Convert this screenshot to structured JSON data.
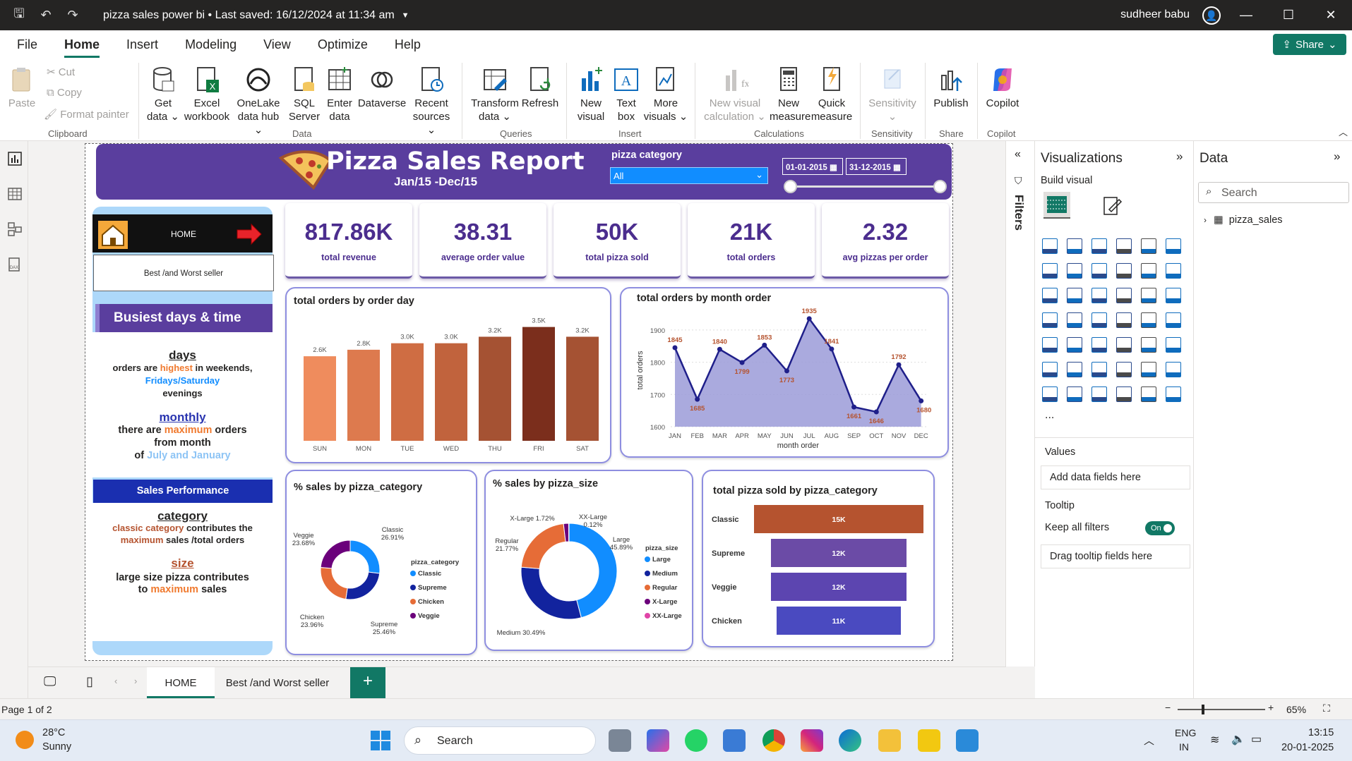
{
  "titlebar": {
    "doc_title": "pizza sales power bi • Last saved: 16/12/2024 at 11:34 am",
    "user": "sudheer babu"
  },
  "menu": {
    "items": [
      "File",
      "Home",
      "Insert",
      "Modeling",
      "View",
      "Optimize",
      "Help"
    ],
    "active": "Home",
    "share": "Share"
  },
  "ribbon": {
    "clipboard": {
      "paste": "Paste",
      "cut": "Cut",
      "copy": "Copy",
      "format_painter": "Format painter",
      "group": "Clipboard"
    },
    "data": {
      "get_data": "Get data",
      "excel": "Excel workbook",
      "onelake": "OneLake data hub",
      "sql": "SQL Server",
      "enter": "Enter data",
      "dataverse": "Dataverse",
      "recent": "Recent sources",
      "group": "Data"
    },
    "queries": {
      "transform": "Transform data",
      "refresh": "Refresh",
      "group": "Queries"
    },
    "insert": {
      "new_visual": "New visual",
      "text_box": "Text box",
      "more_visuals": "More visuals",
      "group": "Insert"
    },
    "calculations": {
      "new_visual_calc": "New visual calculation",
      "new_measure": "New measure",
      "quick_measure": "Quick measure",
      "group": "Calculations"
    },
    "sensitivity": {
      "label": "Sensitivity",
      "group": "Sensitivity"
    },
    "share": {
      "publish": "Publish",
      "group": "Share"
    },
    "copilot": {
      "label": "Copilot",
      "group": "Copilot"
    }
  },
  "report": {
    "title": "Pizza Sales Report",
    "subtitle": "Jan/15 -Dec/15",
    "slicer_label": "pizza category",
    "slicer_value": "All",
    "date_from": "01-01-2015",
    "date_to": "31-12-2015",
    "nav_home": "HOME",
    "nav_best": "Best /and Worst seller",
    "busiest_header": "Busiest days & time",
    "days_head": "days",
    "days_t1": "orders are ",
    "days_t2": "highest",
    "days_t3": " in weekends,",
    "days_t4": "Fridays/Saturday",
    "days_t5": "evenings",
    "monthly_head": "monthly",
    "m_t1": "there are ",
    "m_t2": "maximum",
    "m_t3": " orders",
    "m_t4": "from month",
    "m_t5": "of ",
    "m_t6": "July and  January",
    "perf_header": "Sales Performance",
    "cat_head": "category",
    "c_t1": "classic category",
    "c_t2": " contributes the",
    "c_t3": "maximum",
    "c_t4": " sales /total orders",
    "size_head": "size",
    "s_t1": "large size pizza contributes",
    "s_t2": "to ",
    "s_t3": "maximum",
    "s_t4": " sales"
  },
  "kpis": [
    {
      "value": "817.86K",
      "label": "total revenue"
    },
    {
      "value": "38.31",
      "label": "average order value"
    },
    {
      "value": "50K",
      "label": "total pizza sold"
    },
    {
      "value": "21K",
      "label": "total orders"
    },
    {
      "value": "2.32",
      "label": "avg pizzas per order"
    }
  ],
  "chart_data": [
    {
      "type": "bar",
      "title": "total orders by order day",
      "categories": [
        "SUN",
        "MON",
        "TUE",
        "WED",
        "THU",
        "FRI",
        "SAT"
      ],
      "values": [
        2.6,
        2.8,
        3.0,
        3.0,
        3.2,
        3.5,
        3.2
      ],
      "labels": [
        "2.6K",
        "2.8K",
        "3.0K",
        "3.0K",
        "3.2K",
        "3.5K",
        "3.2K"
      ],
      "colors": [
        "#ef8c5d",
        "#dd7a4e",
        "#cf6d43",
        "#c1633d",
        "#a55233",
        "#7b2e1c",
        "#a55233"
      ]
    },
    {
      "type": "area",
      "title": "total orders by month order",
      "xlabel": "month order",
      "ylabel": "total orders",
      "categories": [
        "JAN",
        "FEB",
        "MAR",
        "APR",
        "MAY",
        "JUN",
        "JUL",
        "AUG",
        "SEP",
        "OCT",
        "NOV",
        "DEC"
      ],
      "values": [
        1845,
        1685,
        1840,
        1799,
        1853,
        1773,
        1935,
        1841,
        1661,
        1646,
        1792,
        1680
      ],
      "yticks": [
        "1900",
        "1800",
        "1700",
        "1600"
      ],
      "ylim": [
        1600,
        1950
      ]
    },
    {
      "type": "pie",
      "title": "% sales by pizza_category",
      "legend_title": "pizza_category",
      "slices": [
        {
          "name": "Classic",
          "pct": 26.91,
          "label": "Classic 26.91%",
          "color": "#118dff"
        },
        {
          "name": "Supreme",
          "pct": 25.46,
          "label": "Supreme 25.46%",
          "color": "#12239e"
        },
        {
          "name": "Chicken",
          "pct": 23.96,
          "label": "Chicken 23.96%",
          "color": "#e66c37"
        },
        {
          "name": "Veggie",
          "pct": 23.68,
          "label": "Veggie 23.68%",
          "color": "#6b007b"
        }
      ]
    },
    {
      "type": "pie",
      "title": "% sales by pizza_size",
      "legend_title": "pizza_size",
      "slices": [
        {
          "name": "Large",
          "pct": 45.89,
          "label": "Large 45.89%",
          "color": "#118dff"
        },
        {
          "name": "Medium",
          "pct": 30.49,
          "label": "Medium 30.49%",
          "color": "#12239e"
        },
        {
          "name": "Regular",
          "pct": 21.77,
          "label": "Regular 21.77%",
          "color": "#e66c37"
        },
        {
          "name": "X-Large",
          "pct": 1.72,
          "label": "X-Large 1.72%",
          "color": "#6b007b"
        },
        {
          "name": "XX-Large",
          "pct": 0.12,
          "label": "XX-Large 0.12%",
          "color": "#e044a7"
        }
      ]
    },
    {
      "type": "bar",
      "orientation": "horizontal",
      "title": "total pizza sold by pizza_category",
      "categories": [
        "Classic",
        "Supreme",
        "Veggie",
        "Chicken"
      ],
      "values": [
        15,
        12,
        12,
        11
      ],
      "labels": [
        "15K",
        "12K",
        "12K",
        "11K"
      ],
      "colors": [
        "#b5532f",
        "#6b4ba6",
        "#5c45b0",
        "#4a4ac0"
      ]
    }
  ],
  "filters": {
    "label": "Filters"
  },
  "viz_pane": {
    "title": "Visualizations",
    "build_visual": "Build visual",
    "values": "Values",
    "add_fields": "Add data fields here",
    "tooltip": "Tooltip",
    "keep_filters": "Keep all filters",
    "toggle": "On",
    "drag_tooltip": "Drag tooltip fields here"
  },
  "data_pane": {
    "title": "Data",
    "search_placeholder": "Search",
    "table": "pizza_sales"
  },
  "pages": {
    "tabs": [
      "HOME",
      "Best /and Worst seller"
    ],
    "active": "HOME",
    "add": "+"
  },
  "status": {
    "page": "Page 1 of 2",
    "zoom": "65%"
  },
  "taskbar": {
    "temp": "28°C",
    "weather": "Sunny",
    "search": "Search",
    "lang1": "ENG",
    "lang2": "IN",
    "time": "13:15",
    "date": "20-01-2025"
  }
}
